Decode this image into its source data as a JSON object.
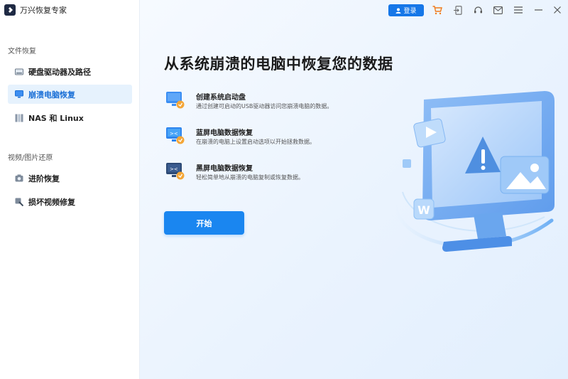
{
  "app": {
    "title": "万兴恢复专家"
  },
  "sidebar": {
    "section1": "文件恢复",
    "section2": "视频/图片还原",
    "items": [
      {
        "label": "硬盘驱动器及路径",
        "icon": "hard-drive-icon"
      },
      {
        "label": "崩溃电脑恢复",
        "icon": "monitor-icon",
        "active": true
      },
      {
        "label": "NAS 和 Linux",
        "icon": "nas-icon"
      },
      {
        "label": "进阶恢复",
        "icon": "camera-icon"
      },
      {
        "label": "损坏视频修复",
        "icon": "repair-icon"
      }
    ]
  },
  "topbar": {
    "login_label": "登录",
    "icons": [
      "cart-icon",
      "sign-in-icon",
      "headset-icon",
      "mail-icon",
      "menu-icon",
      "minimize-icon",
      "close-icon"
    ]
  },
  "main": {
    "title": "从系统崩溃的电脑中恢复您的数据",
    "features": [
      {
        "title": "创建系统启动盘",
        "desc": "通过创建可启动的USB驱动器访问您崩溃电脑的数据。"
      },
      {
        "title": "蓝屏电脑数据恢复",
        "desc": "在崩溃的电脑上设置启动选项以开始拯救数据。"
      },
      {
        "title": "黑屏电脑数据恢复",
        "desc": "轻松简单地从崩溃的电脑复制或恢复数据。"
      }
    ],
    "start_label": "开始",
    "illustration_badge": "W"
  },
  "colors": {
    "accent": "#1677e8",
    "active_bg": "#e6f2fd",
    "active_text": "#1a6fd6"
  }
}
